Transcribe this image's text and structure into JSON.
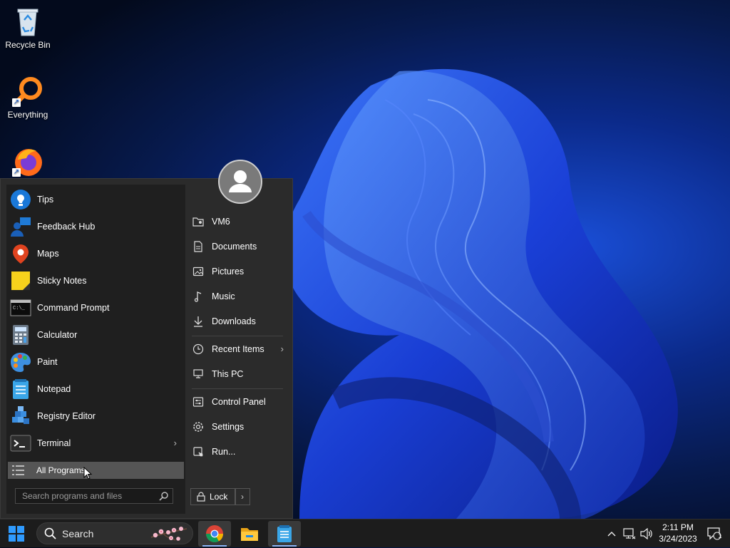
{
  "desktop": {
    "icons": [
      {
        "label": "Recycle Bin",
        "icon": "recycle-bin-icon"
      },
      {
        "label": "Everything",
        "icon": "everything-search-icon"
      },
      {
        "label": "",
        "icon": "firefox-icon"
      }
    ]
  },
  "start_menu": {
    "programs": [
      {
        "label": "Tips",
        "icon": "tips-icon"
      },
      {
        "label": "Feedback Hub",
        "icon": "feedback-hub-icon"
      },
      {
        "label": "Maps",
        "icon": "maps-icon"
      },
      {
        "label": "Sticky Notes",
        "icon": "sticky-notes-icon"
      },
      {
        "label": "Command Prompt",
        "icon": "command-prompt-icon"
      },
      {
        "label": "Calculator",
        "icon": "calculator-icon"
      },
      {
        "label": "Paint",
        "icon": "paint-icon"
      },
      {
        "label": "Notepad",
        "icon": "notepad-icon"
      },
      {
        "label": "Registry Editor",
        "icon": "registry-editor-icon"
      },
      {
        "label": "Terminal",
        "icon": "terminal-icon"
      }
    ],
    "all_programs": "All Programs",
    "search_placeholder": "Search programs and files",
    "right_items": [
      {
        "label": "VM6",
        "icon": "user-folder-icon"
      },
      {
        "label": "Documents",
        "icon": "documents-icon"
      },
      {
        "label": "Pictures",
        "icon": "pictures-icon"
      },
      {
        "label": "Music",
        "icon": "music-icon"
      },
      {
        "label": "Downloads",
        "icon": "downloads-icon"
      },
      {
        "label": "Recent Items",
        "icon": "recent-items-icon"
      },
      {
        "label": "This PC",
        "icon": "this-pc-icon"
      },
      {
        "label": "Control Panel",
        "icon": "control-panel-icon"
      },
      {
        "label": "Settings",
        "icon": "settings-gear-icon"
      },
      {
        "label": "Run...",
        "icon": "run-icon"
      }
    ],
    "lock_label": "Lock"
  },
  "taskbar": {
    "search_label": "Search",
    "apps": [
      {
        "name": "Google Chrome",
        "icon": "chrome-icon",
        "active": true
      },
      {
        "name": "File Explorer",
        "icon": "file-explorer-icon",
        "active": false
      },
      {
        "name": "Notepad",
        "icon": "notepad-icon",
        "active": true
      }
    ],
    "clock": {
      "time": "2:11 PM",
      "date": "3/24/2023"
    },
    "notification_count": "1"
  },
  "colors": {
    "accent": "#0078d4",
    "taskbar_bg": "#1c1c1c",
    "start_bg": "#2b2b2b",
    "selected_item": "#555555"
  }
}
